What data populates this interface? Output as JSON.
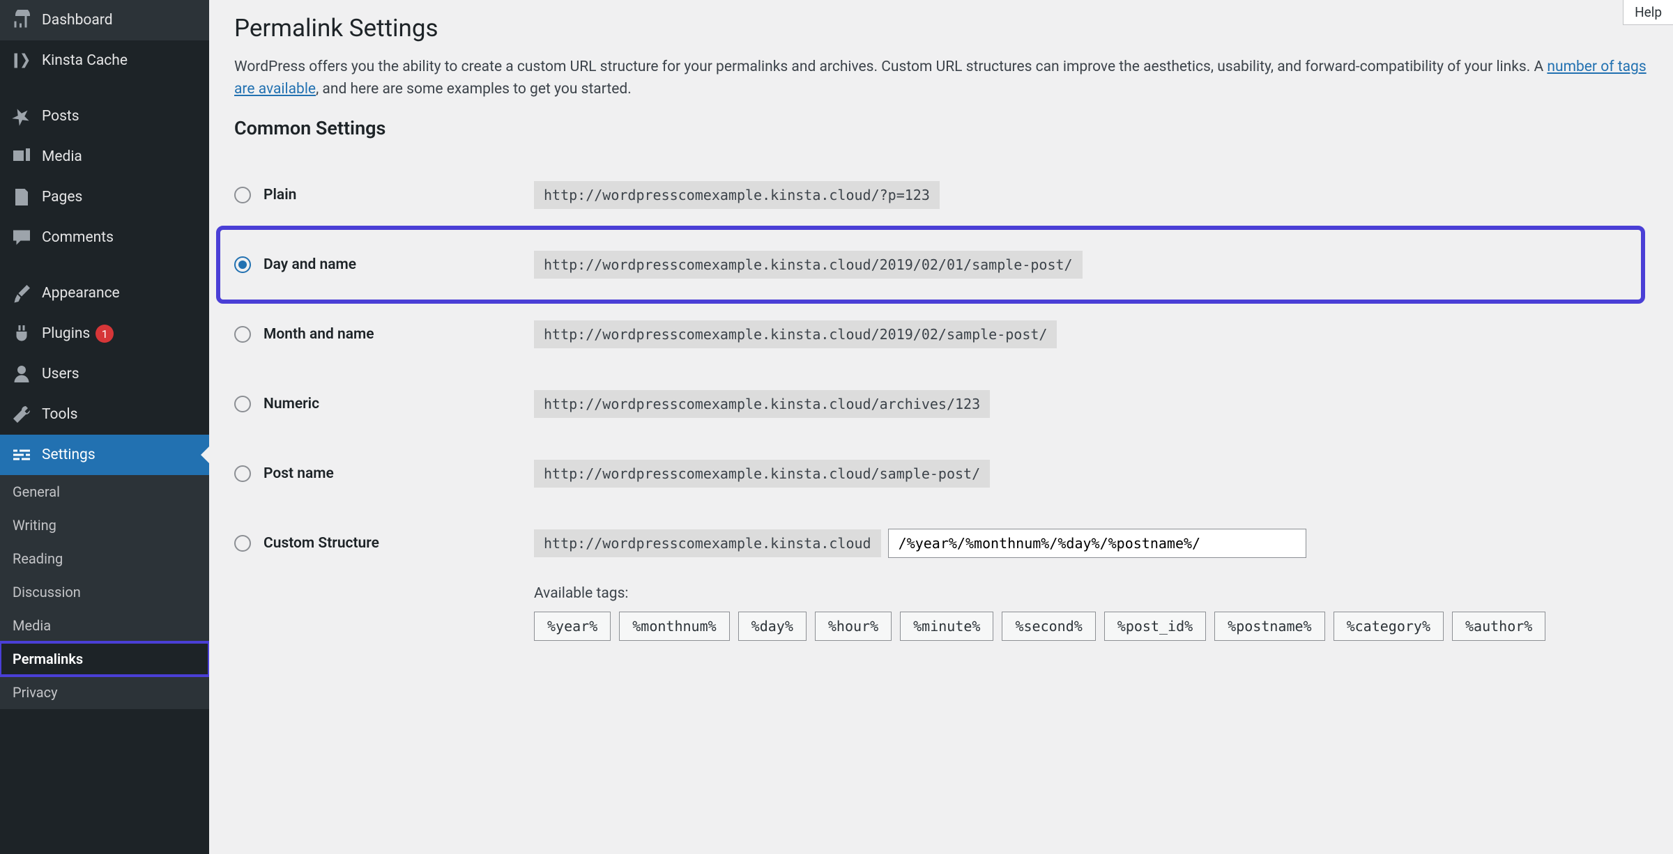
{
  "sidebar": {
    "items": [
      {
        "label": "Dashboard",
        "icon": "dashboard"
      },
      {
        "label": "Kinsta Cache",
        "icon": "kinsta"
      }
    ],
    "group2": [
      {
        "label": "Posts",
        "icon": "pin"
      },
      {
        "label": "Media",
        "icon": "media"
      },
      {
        "label": "Pages",
        "icon": "page"
      },
      {
        "label": "Comments",
        "icon": "comment"
      }
    ],
    "group3": [
      {
        "label": "Appearance",
        "icon": "brush"
      },
      {
        "label": "Plugins",
        "icon": "plug",
        "badge": "1"
      },
      {
        "label": "Users",
        "icon": "user"
      },
      {
        "label": "Tools",
        "icon": "wrench"
      },
      {
        "label": "Settings",
        "icon": "settings",
        "active": true
      }
    ],
    "subitems": [
      "General",
      "Writing",
      "Reading",
      "Discussion",
      "Media",
      "Permalinks",
      "Privacy"
    ],
    "activeSubIndex": 5
  },
  "helpTab": "Help",
  "page": {
    "title": "Permalink Settings",
    "intro_before": "WordPress offers you the ability to create a custom URL structure for your permalinks and archives. Custom URL structures can improve the aesthetics, usability, and forward-compatibility of your links. A ",
    "intro_link": "number of tags are available",
    "intro_after": ", and here are some examples to get you started.",
    "section_title": "Common Settings"
  },
  "options": [
    {
      "name": "Plain",
      "example": "http://wordpresscomexample.kinsta.cloud/?p=123",
      "checked": false
    },
    {
      "name": "Day and name",
      "example": "http://wordpresscomexample.kinsta.cloud/2019/02/01/sample-post/",
      "checked": true,
      "highlighted": true
    },
    {
      "name": "Month and name",
      "example": "http://wordpresscomexample.kinsta.cloud/2019/02/sample-post/",
      "checked": false
    },
    {
      "name": "Numeric",
      "example": "http://wordpresscomexample.kinsta.cloud/archives/123",
      "checked": false
    },
    {
      "name": "Post name",
      "example": "http://wordpresscomexample.kinsta.cloud/sample-post/",
      "checked": false
    }
  ],
  "customOption": {
    "name": "Custom Structure",
    "prefix": "http://wordpresscomexample.kinsta.cloud",
    "value": "/%year%/%monthnum%/%day%/%postname%/",
    "tagsLabel": "Available tags:",
    "tags": [
      "%year%",
      "%monthnum%",
      "%day%",
      "%hour%",
      "%minute%",
      "%second%",
      "%post_id%",
      "%postname%",
      "%category%",
      "%author%"
    ]
  }
}
